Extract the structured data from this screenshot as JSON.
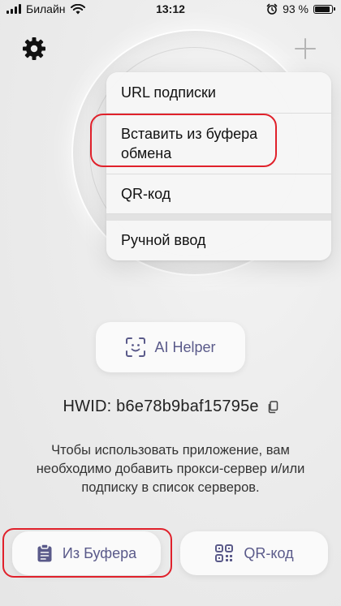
{
  "status_bar": {
    "carrier": "Билайн",
    "time": "13:12",
    "battery_percent": "93 %",
    "battery_level": 0.93
  },
  "header": {
    "settings_icon": "gear-icon",
    "add_icon": "plus-icon"
  },
  "menu": {
    "items": [
      {
        "label": "URL подписки"
      },
      {
        "label": "Вставить из буфера обмена"
      },
      {
        "label": "QR-код"
      },
      {
        "label": "Ручной ввод"
      }
    ]
  },
  "ai_helper": {
    "label": "AI Helper",
    "icon": "ai-face-icon"
  },
  "hwid": {
    "text": "HWID: b6e78b9baf15795e",
    "copy_icon": "copy-icon"
  },
  "info": {
    "text": "Чтобы использовать приложение, вам необходимо добавить прокси-сервер и/или подписку в список серверов."
  },
  "buttons": {
    "clipboard_label": "Из Буфера",
    "qr_label": "QR-код"
  },
  "colors": {
    "highlight": "#e0212b",
    "accent": "#5a5a8a"
  }
}
